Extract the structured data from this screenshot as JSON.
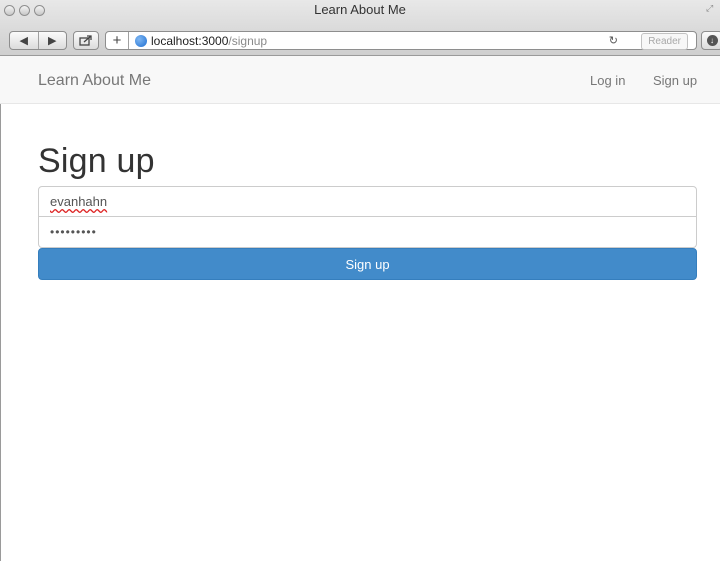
{
  "window": {
    "title": "Learn About Me"
  },
  "browser": {
    "url_host": "localhost:3000",
    "url_path": "/signup",
    "reader_label": "Reader",
    "icons": [
      "back-icon",
      "forward-icon",
      "share-icon",
      "new-tab-icon",
      "globe-icon",
      "reload-icon",
      "download-icon",
      "resize-icon"
    ]
  },
  "navbar": {
    "brand": "Learn About Me",
    "links": [
      "Log in",
      "Sign up"
    ]
  },
  "form": {
    "heading": "Sign up",
    "username_value": "evanhahn",
    "password_value": "•••••••••",
    "submit_label": "Sign up",
    "submit_color": "#428bca"
  }
}
